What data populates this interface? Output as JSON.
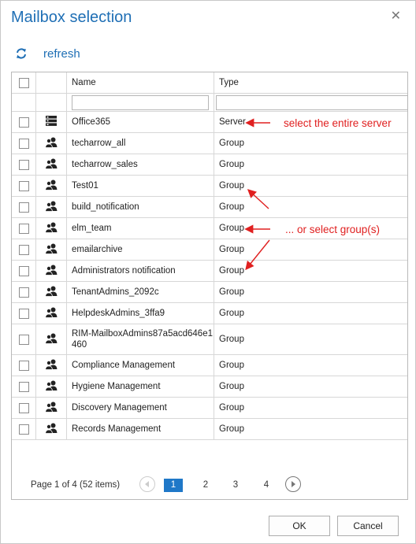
{
  "dialog": {
    "title": "Mailbox selection",
    "close_glyph": "✕"
  },
  "toolbar": {
    "refresh_icon": "refresh-icon",
    "refresh_label": "refresh"
  },
  "grid": {
    "columns": {
      "name": "Name",
      "type": "Type"
    },
    "filters": {
      "name_value": "",
      "type_value": ""
    },
    "rows": [
      {
        "name": "Office365",
        "type": "Server",
        "icon": "server-icon"
      },
      {
        "name": "techarrow_all",
        "type": "Group",
        "icon": "group-icon"
      },
      {
        "name": "techarrow_sales",
        "type": "Group",
        "icon": "group-icon"
      },
      {
        "name": "Test01",
        "type": "Group",
        "icon": "group-icon"
      },
      {
        "name": "build_notification",
        "type": "Group",
        "icon": "group-icon"
      },
      {
        "name": "elm_team",
        "type": "Group",
        "icon": "group-icon"
      },
      {
        "name": "emailarchive",
        "type": "Group",
        "icon": "group-icon"
      },
      {
        "name": "Administrators notification",
        "type": "Group",
        "icon": "group-icon"
      },
      {
        "name": "TenantAdmins_2092c",
        "type": "Group",
        "icon": "group-icon"
      },
      {
        "name": "HelpdeskAdmins_3ffa9",
        "type": "Group",
        "icon": "group-icon"
      },
      {
        "name": "RIM-MailboxAdmins87a5acd646e1460",
        "type": "Group",
        "icon": "group-icon"
      },
      {
        "name": "Compliance Management",
        "type": "Group",
        "icon": "group-icon"
      },
      {
        "name": "Hygiene Management",
        "type": "Group",
        "icon": "group-icon"
      },
      {
        "name": "Discovery Management",
        "type": "Group",
        "icon": "group-icon"
      },
      {
        "name": "Records Management",
        "type": "Group",
        "icon": "group-icon"
      }
    ]
  },
  "pager": {
    "info": "Page 1 of 4 (52 items)",
    "pages": [
      "1",
      "2",
      "3",
      "4"
    ],
    "current_page": "1"
  },
  "buttons": {
    "ok": "OK",
    "cancel": "Cancel"
  },
  "annotations": {
    "server_note": "select the entire server",
    "group_note": "... or select group(s)"
  },
  "colors": {
    "accent": "#1f6fb5",
    "active_page": "#1f78c8",
    "annotation": "#e02020"
  }
}
